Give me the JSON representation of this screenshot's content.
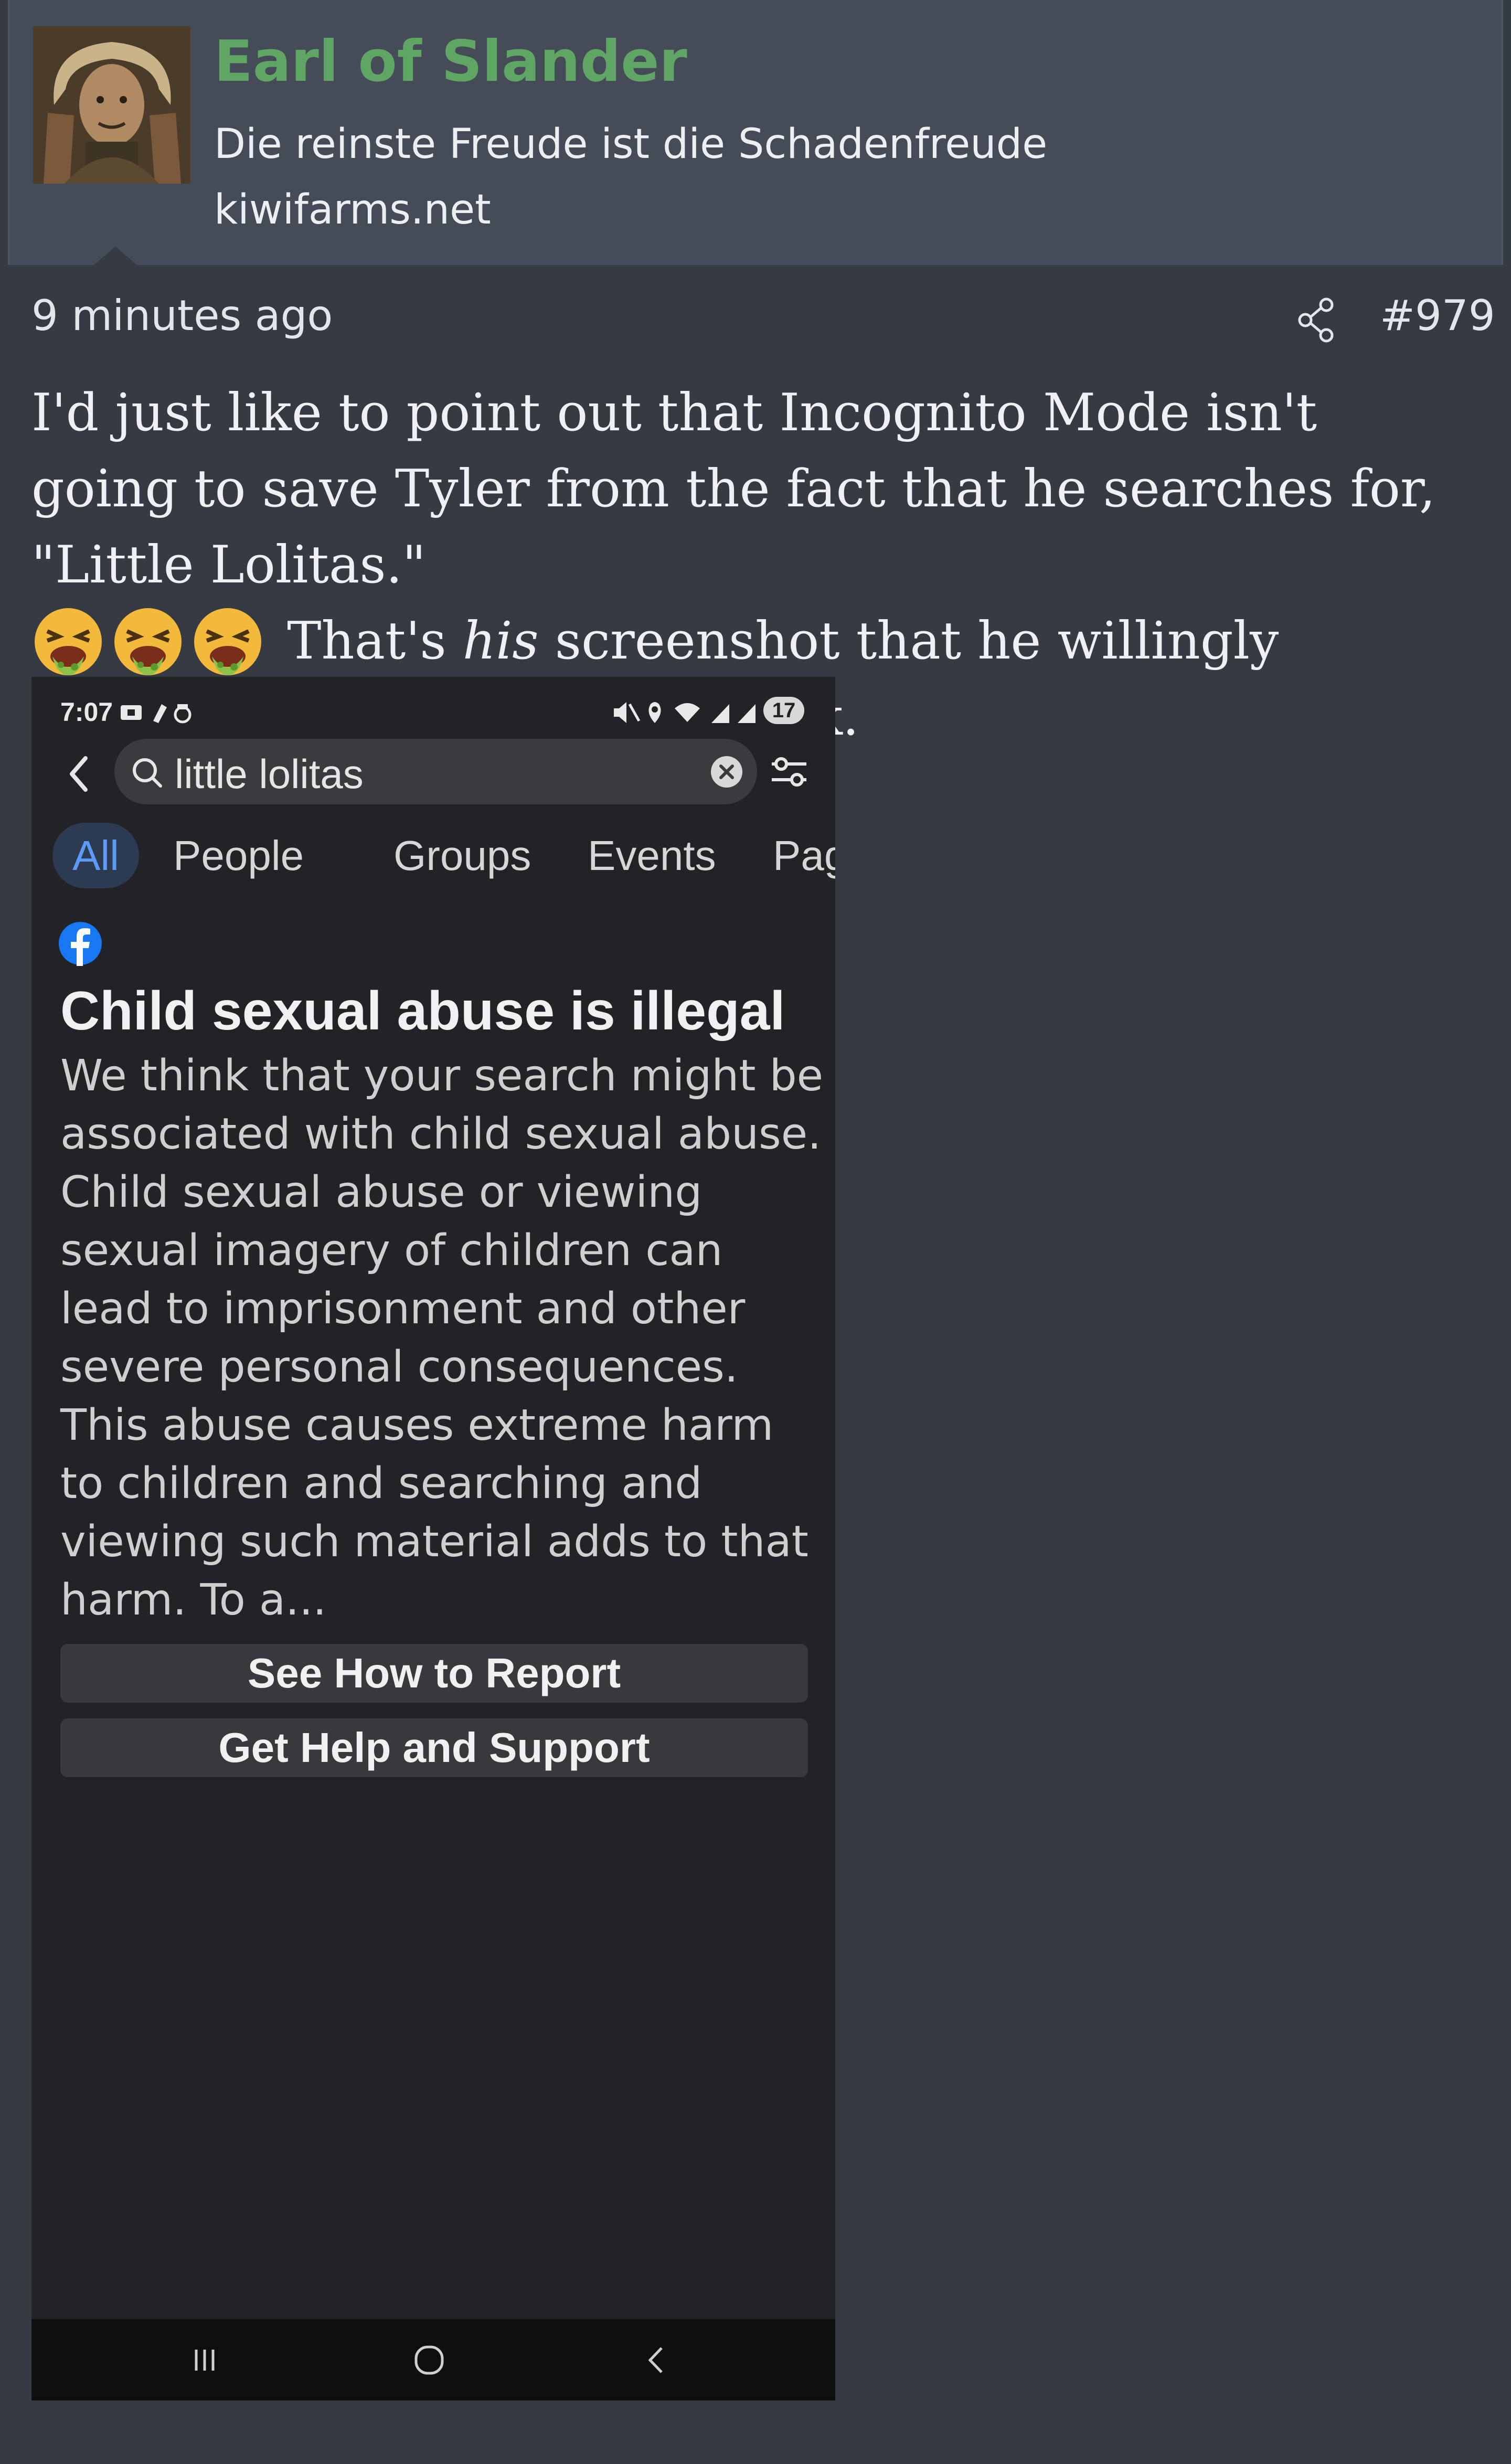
{
  "user": {
    "name": "Earl of Slander",
    "title": "Die reinste Freude ist die Schadenfreude",
    "site": "kiwifarms.net"
  },
  "post": {
    "time": "9 minutes ago",
    "number": "#979",
    "text_1": "I'd just like to point out that Incognito Mode isn't going to save Tyler from the fact that he searches for, \"Little Lolitas.\"",
    "text_2": " That's ",
    "text_2_emph": "his",
    "text_2_rest": " screenshot that he willingly posted. What the absolute fuck.",
    "emoji_count": 3,
    "emoji_icon": "vomiting-face-emoji"
  },
  "screenshot": {
    "status_time": "7:07",
    "battery": "17",
    "search_query": "little lolitas",
    "tabs": [
      "All",
      "People",
      "Groups",
      "Events",
      "Page"
    ],
    "active_tab": "All",
    "warning_title": "Child sexual abuse is illegal",
    "warning_body": "We think that your search might be associated with child sexual abuse. Child sexual abuse or viewing sexual imagery of children can lead to imprisonment and other severe personal consequences. This abuse causes extreme harm to children and searching and viewing such material adds to that harm. To a...",
    "button_report": "See How to Report",
    "button_help": "Get Help and Support"
  },
  "colors": {
    "username": "#5fa564",
    "background": "#363a42",
    "header": "#454b57",
    "active_tab": "#5b9bf5",
    "facebook_blue": "#1877f2"
  }
}
